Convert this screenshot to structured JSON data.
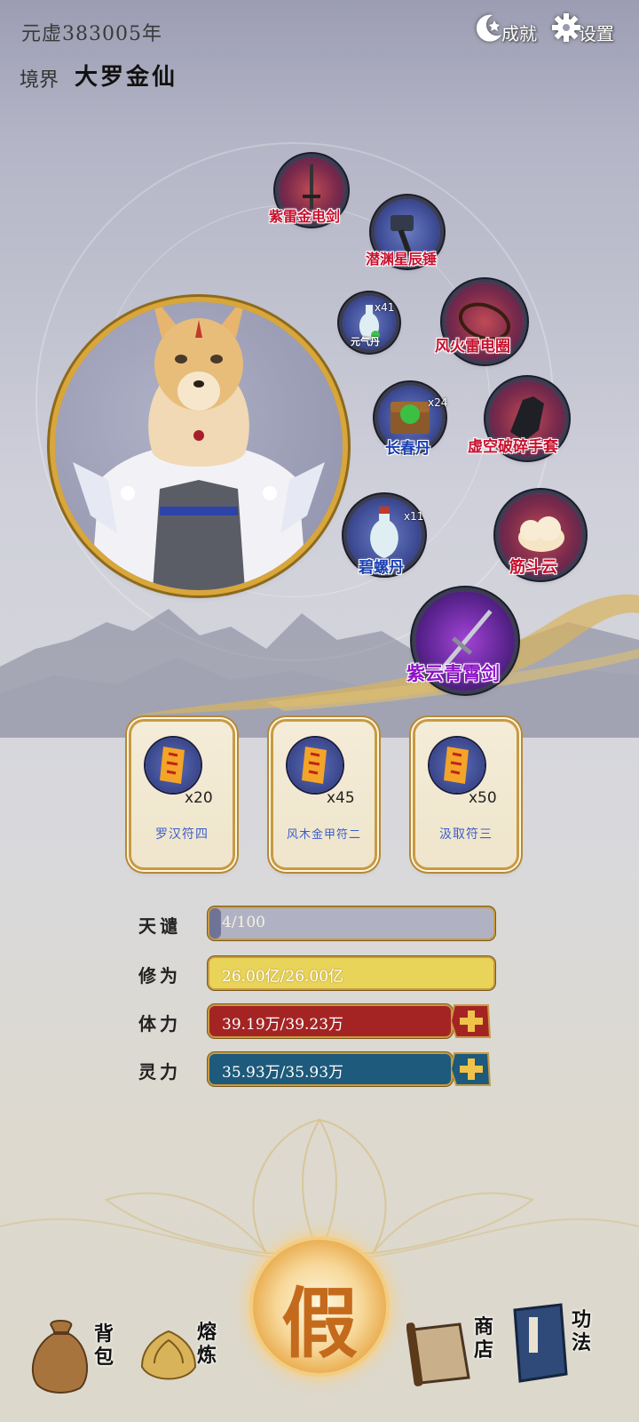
{
  "header": {
    "era_text": "元虚383005年",
    "realm_label": "境界",
    "realm_value": "大罗金仙",
    "achievements_label": "成就",
    "settings_label": "设置",
    "achievements_icon": "moon-star-icon",
    "settings_icon": "gear-icon"
  },
  "equipment": [
    {
      "name": "紫雷金电剑",
      "count": "",
      "icon": "sword-icon"
    },
    {
      "name": "潜渊星辰锤",
      "count": "",
      "icon": "hammer-icon"
    },
    {
      "name": "元气丹",
      "count": "x41",
      "icon": "vase-icon"
    },
    {
      "name": "风火雷电圈",
      "count": "",
      "icon": "ring-icon"
    },
    {
      "name": "长春丹",
      "count": "x24",
      "icon": "chest-icon"
    },
    {
      "name": "虚空破碎手套",
      "count": "",
      "icon": "gauntlet-icon"
    },
    {
      "name": "碧螺丹",
      "count": "x11",
      "icon": "vase-icon"
    },
    {
      "name": "筋斗云",
      "count": "",
      "icon": "cloud-icon"
    },
    {
      "name": "紫云青霄剑",
      "count": "",
      "icon": "sword-icon"
    }
  ],
  "talismans": [
    {
      "name": "罗汉符四",
      "count": "x20",
      "icon": "scroll-icon"
    },
    {
      "name": "风木金甲符二",
      "count": "x45",
      "icon": "scroll-icon"
    },
    {
      "name": "汲取符三",
      "count": "x50",
      "icon": "scroll-icon"
    }
  ],
  "stats": {
    "tianqian": {
      "label": "天谴",
      "text": "4/100",
      "fraction": 0.04
    },
    "xiuwei": {
      "label": "修为",
      "text": "26.00亿/26.00亿",
      "fraction": 1.0
    },
    "tili": {
      "label": "体力",
      "text": "39.19万/39.23万",
      "fraction": 0.999
    },
    "lingli": {
      "label": "灵力",
      "text": "35.93万/35.93万",
      "fraction": 1.0
    }
  },
  "nav": {
    "bag": "背包",
    "smelt": "熔炼",
    "main": "假",
    "shop": "商店",
    "skills": "功法"
  },
  "colors": {
    "tianqian_bar": "#6f7397",
    "xiuwei_bar": "#e9d45a",
    "tili_bar": "#a42424",
    "lingli_bar": "#1d5a7b",
    "gold": "#c99a3f"
  }
}
